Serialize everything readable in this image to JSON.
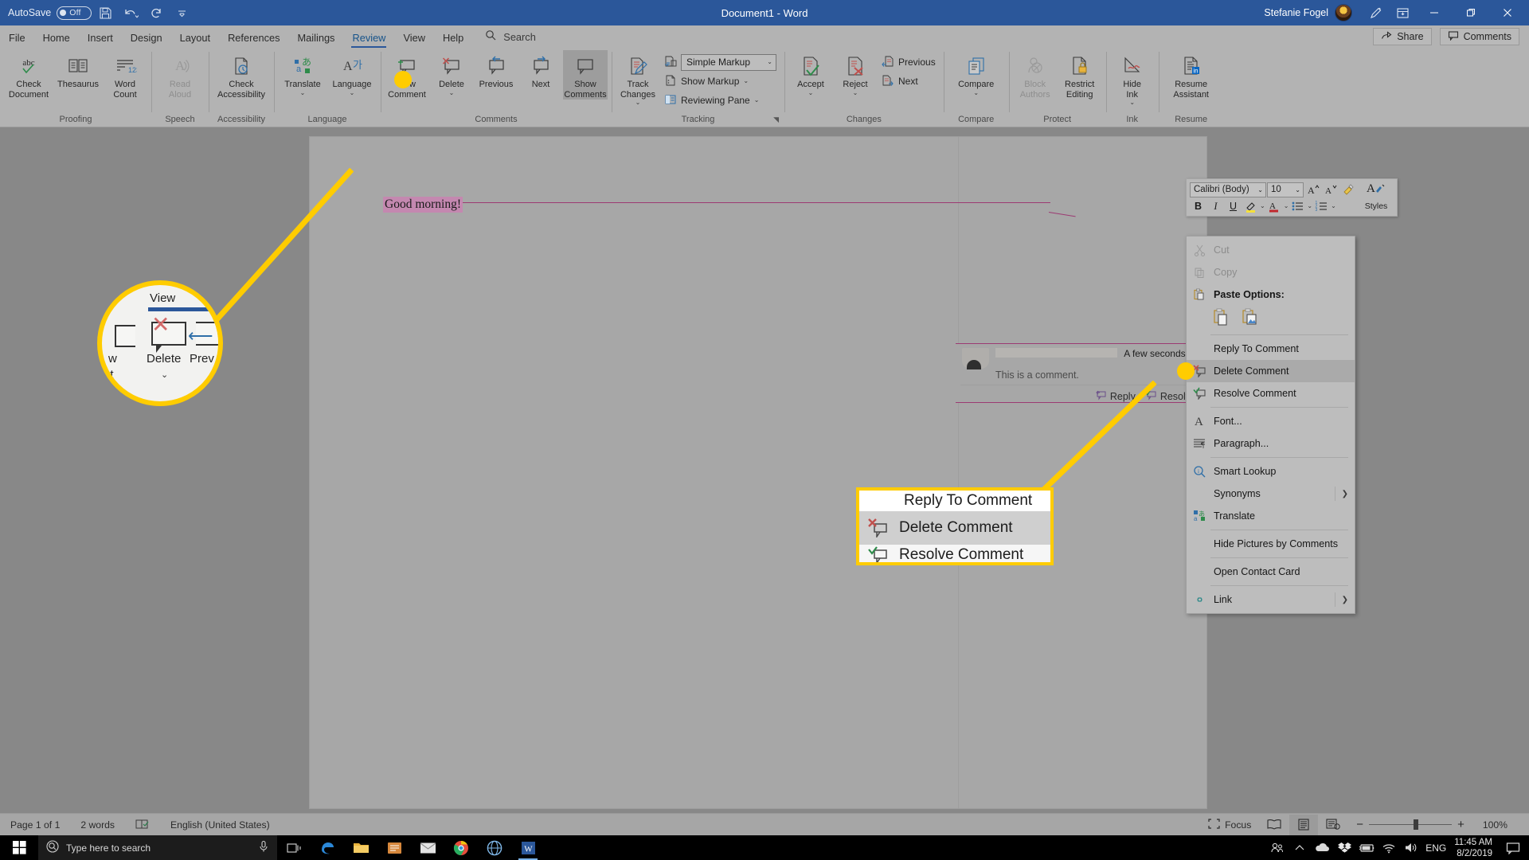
{
  "titlebar": {
    "autosave_label": "AutoSave",
    "autosave_state": "Off",
    "document_title": "Document1  -  Word",
    "user_name": "Stefanie Fogel",
    "icons": [
      "save-icon",
      "undo-icon",
      "redo-icon",
      "customize-qat-icon"
    ],
    "window_buttons": [
      "minimize",
      "restore",
      "close"
    ]
  },
  "ribbon_tabs": {
    "items": [
      {
        "label": "File",
        "active": false
      },
      {
        "label": "Home",
        "active": false
      },
      {
        "label": "Insert",
        "active": false
      },
      {
        "label": "Design",
        "active": false
      },
      {
        "label": "Layout",
        "active": false
      },
      {
        "label": "References",
        "active": false
      },
      {
        "label": "Mailings",
        "active": false
      },
      {
        "label": "Review",
        "active": true
      },
      {
        "label": "View",
        "active": false
      },
      {
        "label": "Help",
        "active": false
      }
    ],
    "search_placeholder": "Search",
    "share_label": "Share",
    "comments_label": "Comments"
  },
  "ribbon": {
    "groups": [
      {
        "name": "Proofing",
        "buttons": [
          {
            "label": "Check\nDocument",
            "line1": "Check",
            "line2": "Document",
            "icon": "spelling-check-icon",
            "disabled": false
          },
          {
            "label": "Thesaurus",
            "line1": "Thesaurus",
            "line2": "",
            "icon": "thesaurus-icon",
            "disabled": false
          },
          {
            "label": "Word Count",
            "line1": "Word",
            "line2": "Count",
            "icon": "word-count-icon",
            "disabled": false
          }
        ]
      },
      {
        "name": "Speech",
        "buttons": [
          {
            "label": "Read Aloud",
            "line1": "Read",
            "line2": "Aloud",
            "icon": "read-aloud-icon",
            "disabled": true
          }
        ]
      },
      {
        "name": "Accessibility",
        "buttons": [
          {
            "label": "Check Accessibility",
            "line1": "Check",
            "line2": "Accessibility",
            "icon": "check-accessibility-icon",
            "disabled": false
          }
        ]
      },
      {
        "name": "Language",
        "buttons": [
          {
            "label": "Translate",
            "line1": "Translate",
            "line2": "",
            "icon": "translate-icon",
            "disabled": false,
            "dropdown": true
          },
          {
            "label": "Language",
            "line1": "Language",
            "line2": "",
            "icon": "language-icon",
            "disabled": false,
            "dropdown": true
          }
        ]
      },
      {
        "name": "Comments",
        "buttons": [
          {
            "label": "New Comment",
            "line1": "New",
            "line2": "Comment",
            "icon": "new-comment-icon",
            "disabled": false
          },
          {
            "label": "Delete",
            "line1": "Delete",
            "line2": "",
            "icon": "delete-comment-icon",
            "disabled": false,
            "dropdown": true
          },
          {
            "label": "Previous",
            "line1": "Previous",
            "line2": "",
            "icon": "previous-comment-icon",
            "disabled": false
          },
          {
            "label": "Next",
            "line1": "Next",
            "line2": "",
            "icon": "next-comment-icon",
            "disabled": false
          },
          {
            "label": "Show Comments",
            "line1": "Show",
            "line2": "Comments",
            "icon": "show-comments-icon",
            "disabled": false,
            "active": true
          }
        ]
      },
      {
        "name": "Tracking",
        "buttons": [
          {
            "label": "Track Changes",
            "line1": "Track",
            "line2": "Changes",
            "icon": "track-changes-icon",
            "dropdown": true
          }
        ],
        "small_items": [
          {
            "label": "Simple Markup",
            "icon": "markup-view-icon",
            "is_combo": true
          },
          {
            "label": "Show Markup",
            "icon": "show-markup-icon",
            "dropdown": true
          },
          {
            "label": "Reviewing Pane",
            "icon": "reviewing-pane-icon",
            "dropdown": true
          }
        ],
        "dialog_launcher": true
      },
      {
        "name": "Changes",
        "buttons": [
          {
            "label": "Accept",
            "line1": "Accept",
            "line2": "",
            "icon": "accept-change-icon",
            "dropdown": true
          },
          {
            "label": "Reject",
            "line1": "Reject",
            "line2": "",
            "icon": "reject-change-icon",
            "dropdown": true
          }
        ],
        "small_items": [
          {
            "label": "Previous",
            "icon": "previous-change-icon"
          },
          {
            "label": "Next",
            "icon": "next-change-icon"
          }
        ]
      },
      {
        "name": "Compare",
        "buttons": [
          {
            "label": "Compare",
            "line1": "Compare",
            "line2": "",
            "icon": "compare-icon",
            "dropdown": true
          }
        ]
      },
      {
        "name": "Protect",
        "buttons": [
          {
            "label": "Block Authors",
            "line1": "Block",
            "line2": "Authors",
            "icon": "block-authors-icon",
            "disabled": true,
            "dropdown": true
          },
          {
            "label": "Restrict Editing",
            "line1": "Restrict",
            "line2": "Editing",
            "icon": "restrict-editing-icon",
            "disabled": false
          }
        ]
      },
      {
        "name": "Ink",
        "buttons": [
          {
            "label": "Hide Ink",
            "line1": "Hide",
            "line2": "Ink",
            "icon": "hide-ink-icon",
            "dropdown": true
          }
        ]
      },
      {
        "name": "Resume",
        "buttons": [
          {
            "label": "Resume Assistant",
            "line1": "Resume",
            "line2": "Assistant",
            "icon": "resume-assistant-icon"
          }
        ]
      }
    ]
  },
  "document": {
    "body_text": "Good morning!"
  },
  "comment_card": {
    "timestamp": "A few seconds ago",
    "text": "This is a comment.",
    "reply_label": "Reply",
    "resolve_label": "Resolve"
  },
  "mini_toolbar": {
    "font_name": "Calibri (Body)",
    "font_size": "10",
    "buttons": [
      "grow-font-icon",
      "shrink-font-icon",
      "format-painter-icon",
      "bold-icon",
      "italic-icon",
      "underline-icon",
      "highlight-icon",
      "font-color-icon",
      "bullets-icon",
      "numbering-icon"
    ],
    "bold_label": "B",
    "italic_label": "I",
    "underline_label": "U",
    "font_color_label": "A",
    "styles_label": "Styles"
  },
  "context_menu": {
    "items": [
      {
        "label": "Cut",
        "icon": "cut-icon",
        "disabled": true,
        "underline_index": 1
      },
      {
        "label": "Copy",
        "icon": "copy-icon",
        "disabled": true
      },
      {
        "label": "Paste Options:",
        "icon": "paste-icon",
        "bold": true
      },
      {
        "label": "Reply To Comment",
        "icon": "",
        "indent": true
      },
      {
        "label": "Delete Comment",
        "icon": "delete-comment-icon",
        "selected": true
      },
      {
        "label": "Resolve Comment",
        "icon": "resolve-comment-icon"
      },
      {
        "label": "Font...",
        "icon": "font-icon"
      },
      {
        "label": "Paragraph...",
        "icon": "paragraph-icon"
      },
      {
        "label": "Smart Lookup",
        "icon": "smart-lookup-icon"
      },
      {
        "label": "Synonyms",
        "icon": "",
        "submenu": true
      },
      {
        "label": "Translate",
        "icon": "translate-icon"
      },
      {
        "label": "Hide Pictures by Comments",
        "icon": ""
      },
      {
        "label": "Open Contact Card",
        "icon": ""
      },
      {
        "label": "Link",
        "icon": "link-icon",
        "submenu": true
      }
    ],
    "paste_options": [
      "keep-source-formatting-icon",
      "picture-icon"
    ]
  },
  "magnifier": {
    "tab_text": "View",
    "center_label": "Delete",
    "left_label": "w",
    "left_label2": "nt",
    "right_label": "Prev"
  },
  "zoom_callout": {
    "top_item": "Reply To Comment",
    "selected_item": "Delete Comment",
    "bottom_item": "Resolve Comment"
  },
  "statusbar": {
    "page": "Page 1 of 1",
    "words": "2 words",
    "proofing_icon": "proofing-errors-icon",
    "language": "English (United States)",
    "focus_label": "Focus",
    "view_icons": [
      "read-mode-icon",
      "print-layout-icon",
      "web-layout-icon"
    ],
    "zoom_out": "−",
    "zoom_in": "+",
    "zoom_level": "100%"
  },
  "taskbar": {
    "start_icon": "windows-start-icon",
    "search_placeholder": "Type here to search",
    "mic_icon": "microphone-icon",
    "task_view_icon": "task-view-icon",
    "apps": [
      "edge-icon",
      "file-explorer-icon",
      "store-icon",
      "mail-icon",
      "chrome-icon",
      "browser-icon",
      "word-icon"
    ],
    "tray_icons": [
      "people-icon",
      "show-hidden-icon",
      "onedrive-icon",
      "dropbox-icon",
      "battery-icon",
      "wifi-icon",
      "volume-icon"
    ],
    "language": "ENG",
    "time": "11:45 AM",
    "date": "8/2/2019",
    "action_center_icon": "action-center-icon"
  },
  "colors": {
    "title_blue": "#2b579a",
    "accent_yellow": "#FFCC00",
    "comment_purple": "#9c3a72",
    "highlight_pink": "#c488b0"
  }
}
